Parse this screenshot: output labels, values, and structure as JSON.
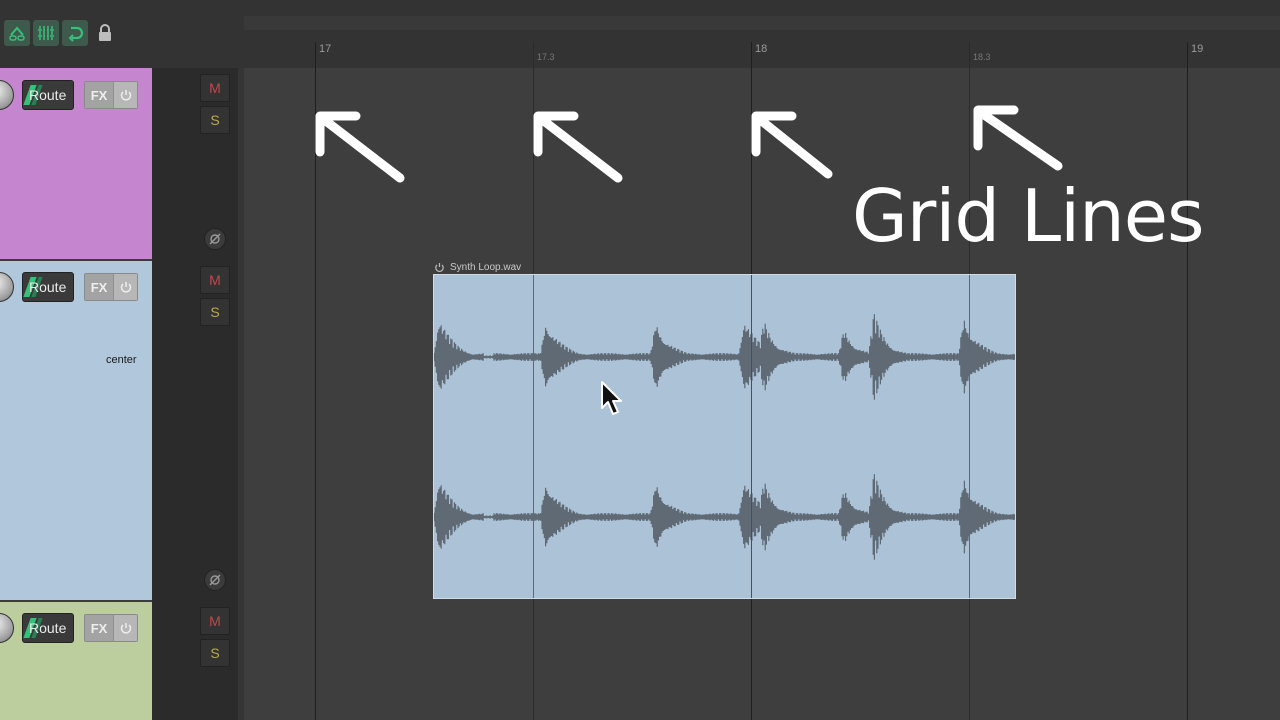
{
  "ruler": {
    "marks": [
      "17",
      "17.3",
      "18",
      "18.3",
      "19"
    ]
  },
  "tracks": [
    {
      "route_label": "Route",
      "fx_label": "FX",
      "mute_label": "M",
      "solo_label": "S",
      "color": "#c586cf"
    },
    {
      "route_label": "Route",
      "fx_label": "FX",
      "mute_label": "M",
      "solo_label": "S",
      "color": "#b1c8dc",
      "pan_label": "center"
    },
    {
      "route_label": "Route",
      "fx_label": "FX",
      "mute_label": "M",
      "solo_label": "S",
      "color": "#bccd9e"
    }
  ],
  "item": {
    "name": "Synth Loop.wav",
    "color": "#abc2d7"
  },
  "annotation": {
    "text": "Grid Lines"
  },
  "toolbar": {
    "icons": [
      "envelope-link-icon",
      "grid-snap-icon",
      "loop-icon",
      "lock-icon"
    ],
    "accent": "#37c07a"
  }
}
